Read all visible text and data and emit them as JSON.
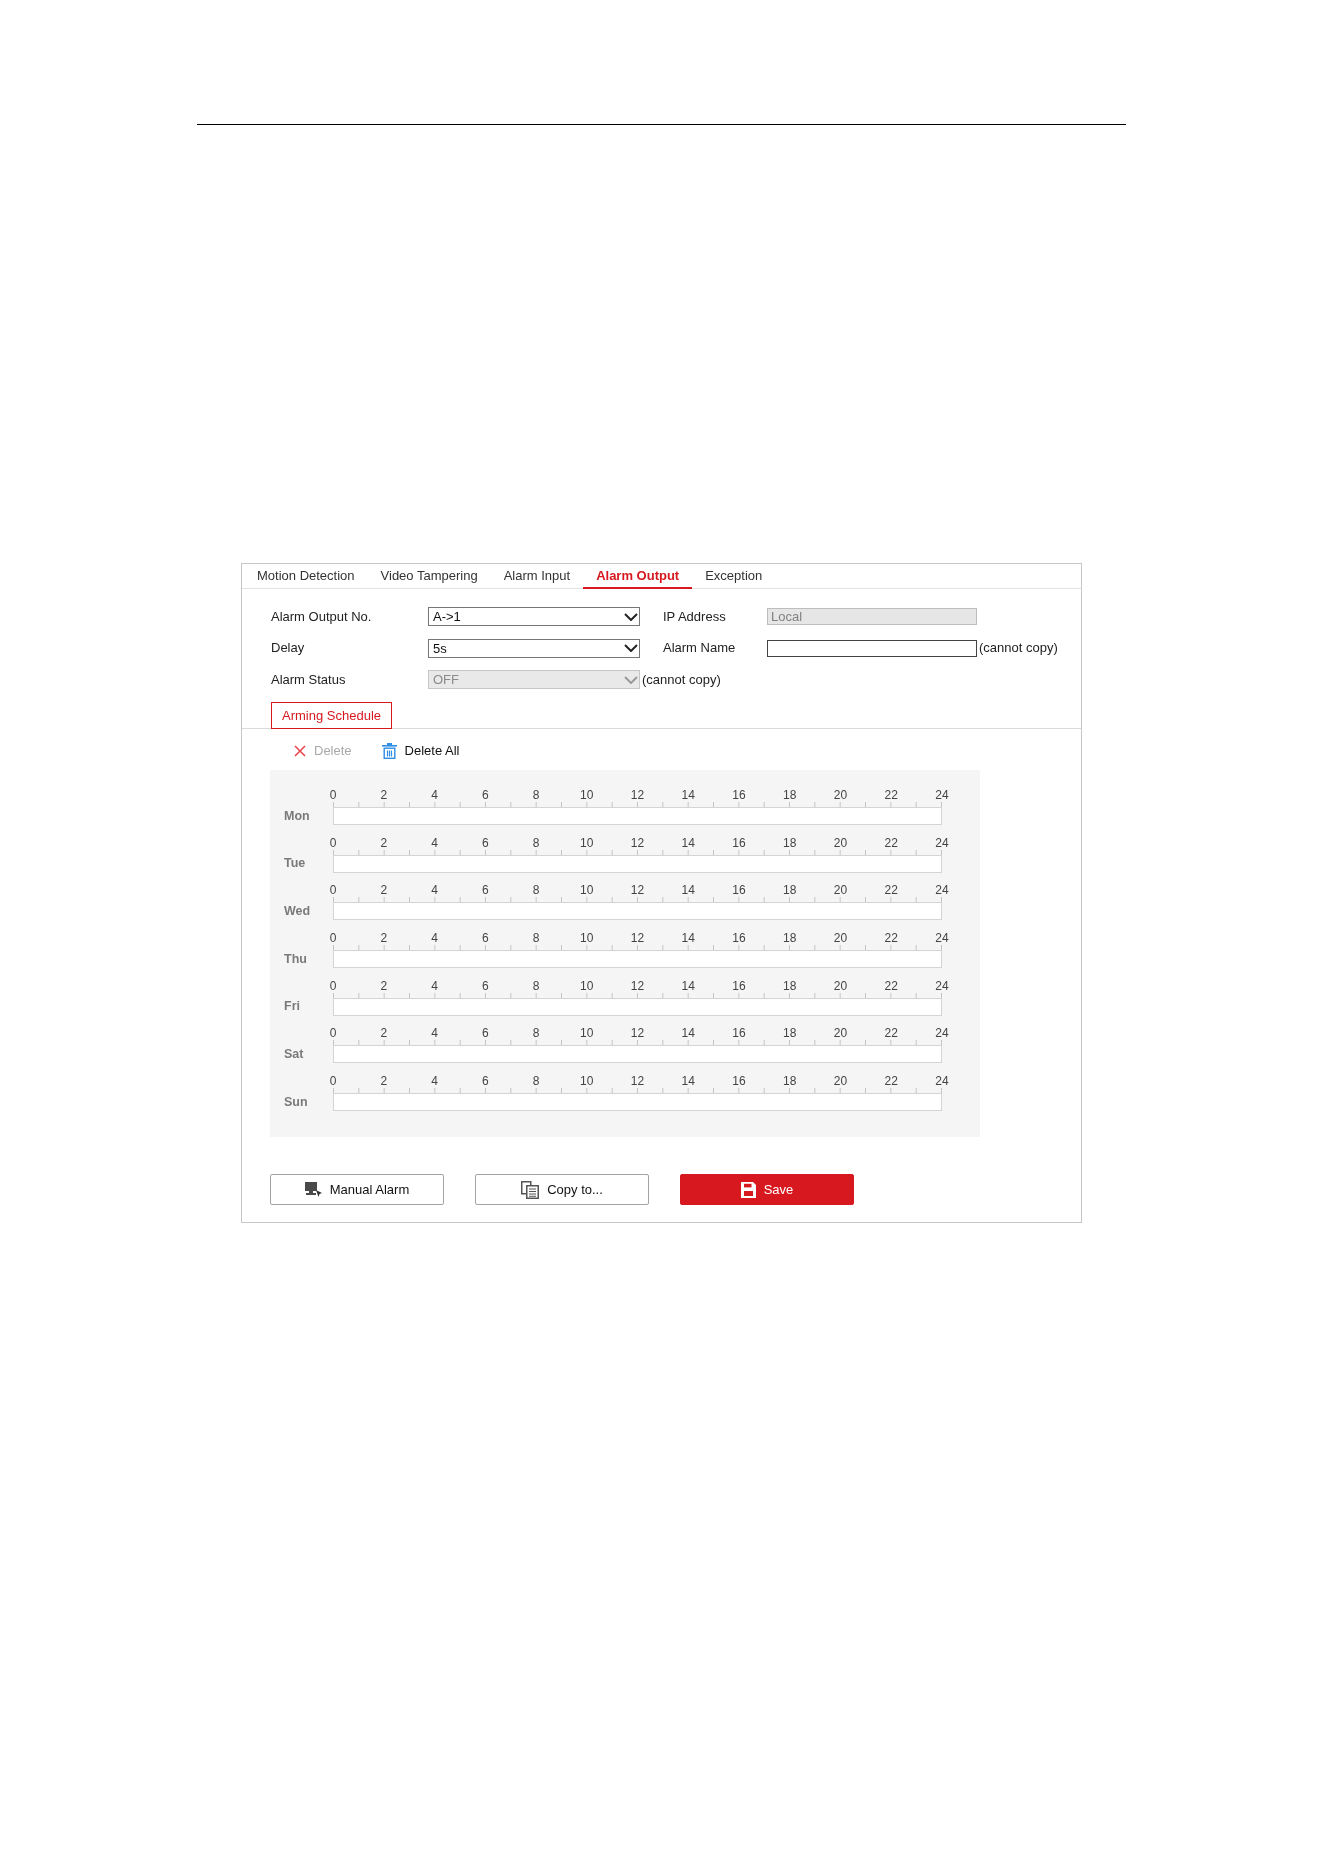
{
  "tabs": [
    {
      "label": "Motion Detection",
      "selected": false
    },
    {
      "label": "Video Tampering",
      "selected": false
    },
    {
      "label": "Alarm Input",
      "selected": false
    },
    {
      "label": "Alarm Output",
      "selected": true
    },
    {
      "label": "Exception",
      "selected": false
    }
  ],
  "form_rows": [
    [
      {
        "kind": "select",
        "label": "Alarm Output No.",
        "value": "A->1",
        "disabled": false
      },
      {
        "kind": "text",
        "label": "IP Address",
        "value": "Local",
        "disabled": true
      }
    ],
    [
      {
        "kind": "select",
        "label": "Delay",
        "value": "5s",
        "disabled": false
      },
      {
        "kind": "text",
        "label": "Alarm Name",
        "disabled": false,
        "note": "(cannot copy)"
      }
    ],
    [
      {
        "kind": "select",
        "label": "Alarm Status",
        "value": "OFF",
        "disabled": true,
        "note": "(cannot copy)"
      }
    ]
  ],
  "subtabs": [
    {
      "label": "Arming Schedule",
      "selected": true
    }
  ],
  "toolbar": [
    {
      "kind": "delete",
      "label": "Delete",
      "disabled": true
    },
    {
      "kind": "delete_all",
      "label": "Delete All",
      "disabled": false
    }
  ],
  "schedule": {
    "days": [
      {
        "label": "Mon",
        "hours": [
          "0",
          "2",
          "4",
          "6",
          "8",
          "10",
          "12",
          "14",
          "16",
          "18",
          "20",
          "22",
          "24"
        ]
      },
      {
        "label": "Tue",
        "hours": [
          "0",
          "2",
          "4",
          "6",
          "8",
          "10",
          "12",
          "14",
          "16",
          "18",
          "20",
          "22",
          "24"
        ]
      },
      {
        "label": "Wed",
        "hours": [
          "0",
          "2",
          "4",
          "6",
          "8",
          "10",
          "12",
          "14",
          "16",
          "18",
          "20",
          "22",
          "24"
        ]
      },
      {
        "label": "Thu",
        "hours": [
          "0",
          "2",
          "4",
          "6",
          "8",
          "10",
          "12",
          "14",
          "16",
          "18",
          "20",
          "22",
          "24"
        ]
      },
      {
        "label": "Fri",
        "hours": [
          "0",
          "2",
          "4",
          "6",
          "8",
          "10",
          "12",
          "14",
          "16",
          "18",
          "20",
          "22",
          "24"
        ]
      },
      {
        "label": "Sat",
        "hours": [
          "0",
          "2",
          "4",
          "6",
          "8",
          "10",
          "12",
          "14",
          "16",
          "18",
          "20",
          "22",
          "24"
        ]
      },
      {
        "label": "Sun",
        "hours": [
          "0",
          "2",
          "4",
          "6",
          "8",
          "10",
          "12",
          "14",
          "16",
          "18",
          "20",
          "22",
          "24"
        ]
      }
    ]
  },
  "buttons": [
    {
      "kind": "manual_alarm",
      "label": "Manual Alarm"
    },
    {
      "kind": "copy",
      "label": "Copy to..."
    },
    {
      "kind": "save",
      "label": "Save"
    }
  ]
}
